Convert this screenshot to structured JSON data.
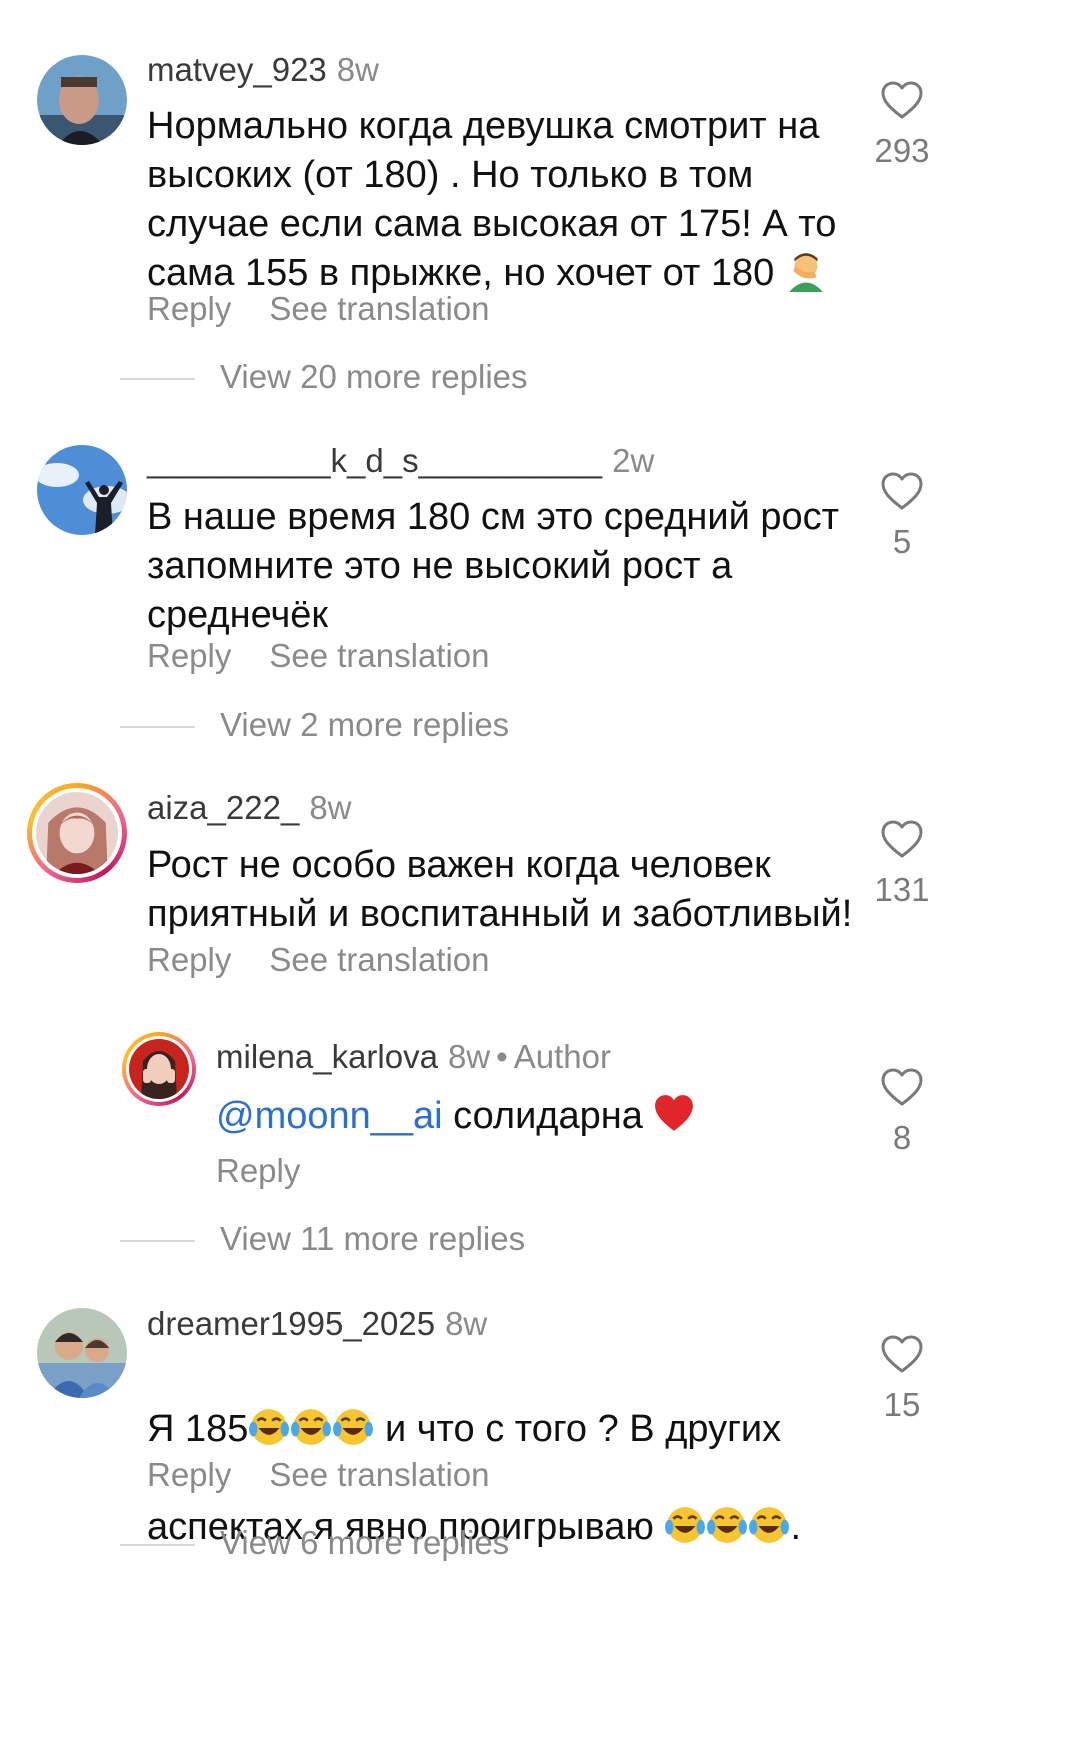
{
  "comments": [
    {
      "username": "matvey_923",
      "time": "8w",
      "text": "Нормально когда девушка смотрит на\nвысоких (от 180) . Но только в том\nслучае если сама высокая от 175!  А то\nсама 155 в прыжке, но хочет от 180",
      "text_emoji": "man-facepalming-emoji",
      "reply_label": "Reply",
      "translate_label": "See translation",
      "likes": "293",
      "more_replies": "View 20 more replies"
    },
    {
      "username": "__________k_d_s__________",
      "time": "2w",
      "text": "В наше время 180 см это средний рост\nзапомните это не высокий рост а\nсреднечёк",
      "reply_label": "Reply",
      "translate_label": "See translation",
      "likes": "5",
      "more_replies": "View 2 more replies"
    },
    {
      "username": "aiza_222_",
      "time": "8w",
      "text": "Рост не особо важен когда человек\nприятный и воспитанный и заботливый!",
      "reply_label": "Reply",
      "translate_label": "See translation",
      "likes": "131",
      "reply": {
        "username": "milena_karlova",
        "time": "8w",
        "author_label": "Author",
        "mention": "@moonn__ai",
        "text": "солидарна",
        "text_emoji": "red-heart-emoji",
        "reply_label": "Reply",
        "likes": "8"
      },
      "more_replies": "View 11 more replies"
    },
    {
      "username": "dreamer1995_2025",
      "time": "8w",
      "text_line1_a": "Я 185",
      "text_line1_b": " и что с того ? В других",
      "text_line2": "аспектах я явно проигрываю ",
      "text_line2_end": ".",
      "text_emoji": "face-with-tears-of-joy-emoji",
      "reply_label": "Reply",
      "translate_label": "See translation",
      "likes": "15",
      "more_replies": "View 6 more replies"
    }
  ],
  "colors": {
    "username": "#3a3a3a",
    "meta": "#8a8a8a",
    "text": "#111111",
    "mention": "#2a6fd6"
  }
}
